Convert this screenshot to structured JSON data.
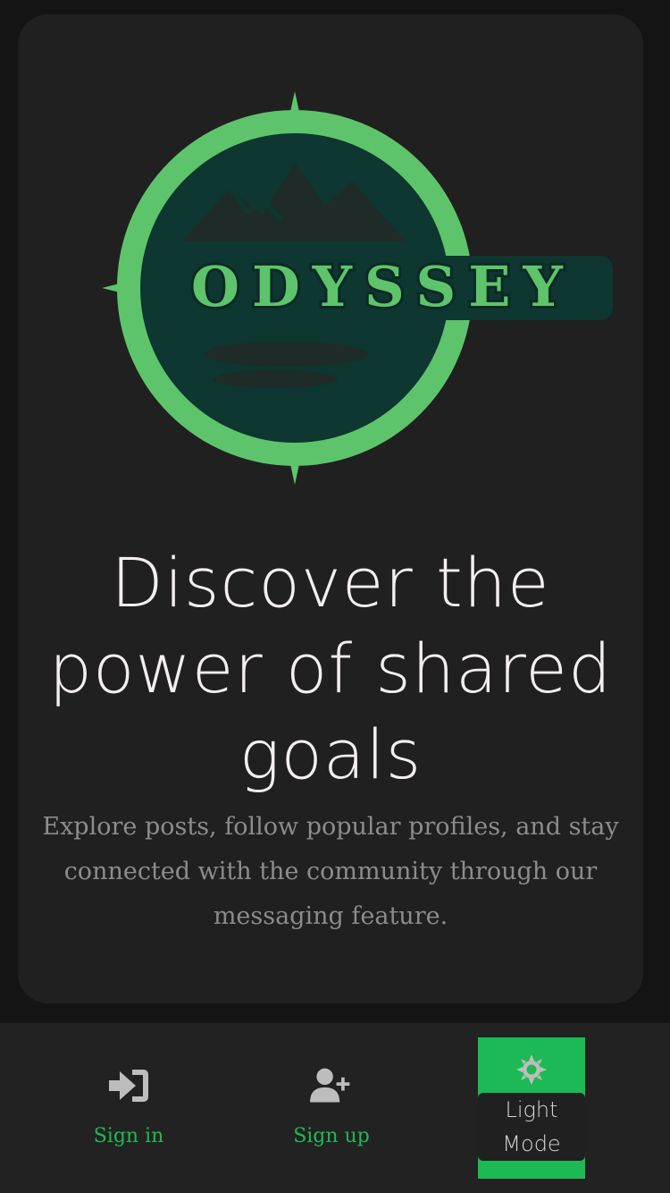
{
  "colors": {
    "background": "#141414",
    "card": "#202020",
    "accent_green": "#1db954",
    "logo_green": "#5ec46b",
    "logo_dark": "#0d3730",
    "headline": "#f3efee",
    "subtext": "#8c8c8c",
    "nav_icon": "#bdbdbd"
  },
  "logo": {
    "text": "ODYSSEY",
    "icon": "compass-mountain-logo"
  },
  "hero": {
    "headline": "Discover the power of shared goals",
    "description": "Explore posts, follow popular profiles, and stay connected with the community through our messaging feature."
  },
  "bottom_nav": {
    "items": [
      {
        "label": "Sign in",
        "icon": "sign-in-icon"
      },
      {
        "label": "Sign up",
        "icon": "user-plus-icon"
      }
    ],
    "mode_toggle": {
      "label": "Light\nMode",
      "icon": "sun-icon"
    }
  }
}
